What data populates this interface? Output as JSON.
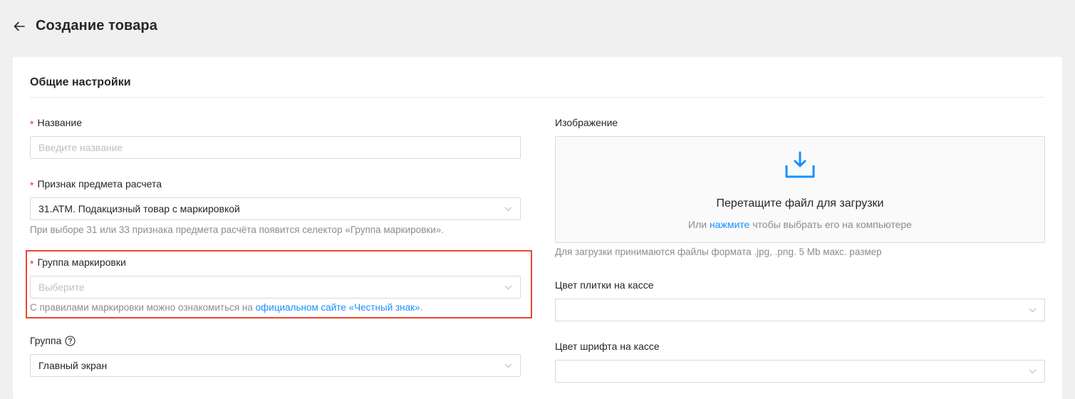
{
  "header": {
    "title": "Создание товара",
    "back_icon": "arrow-left-icon"
  },
  "section": {
    "title": "Общие настройки"
  },
  "name_field": {
    "label": "Название",
    "required": true,
    "placeholder": "Введите название",
    "value": ""
  },
  "payment_subject": {
    "label": "Признак предмета расчета",
    "required": true,
    "value": "31.ATM. Подакцизный товар с маркировкой",
    "hint": "При выборе 31 или 33 признака предмета расчёта появится селектор «Группа маркировки»."
  },
  "marking_group": {
    "label": "Группа маркировки",
    "required": true,
    "placeholder": "Выберите",
    "hint_prefix": "С правилами маркировки можно ознакомиться на ",
    "hint_link": "официальном сайте «Честный знак»",
    "hint_suffix": ".",
    "highlight_color": "#e8472e"
  },
  "group": {
    "label": "Группа",
    "help_icon": "question-circle-icon",
    "value": "Главный экран"
  },
  "image": {
    "label": "Изображение",
    "upload_icon": "download-tray-icon",
    "upload_title": "Перетащите файл для загрузки",
    "upload_sub_prefix": "Или ",
    "upload_sub_link": "нажмите",
    "upload_sub_suffix": " чтобы выбрать его на компьютере",
    "hint": "Для загрузки принимаются файлы формата .jpg, .png. 5 Mb макс. размер"
  },
  "tile_color": {
    "label": "Цвет плитки на кассе",
    "value": ""
  },
  "font_color": {
    "label": "Цвет шрифта на кассе",
    "value": ""
  },
  "colors": {
    "accent": "#1890ff",
    "required": "#f5222d",
    "background": "#f0f0f0"
  }
}
